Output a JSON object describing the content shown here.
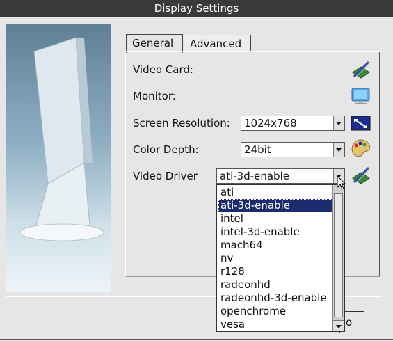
{
  "window": {
    "title": "Display Settings"
  },
  "tabs": [
    {
      "label": "General",
      "active": true
    },
    {
      "label": "Advanced",
      "active": false
    }
  ],
  "rows": {
    "video_card": {
      "label": "Video Card:",
      "icon": "video-card-config-icon"
    },
    "monitor": {
      "label": "Monitor:",
      "icon": "monitor-icon"
    },
    "resolution": {
      "label": "Screen Resolution:",
      "value": "1024x768",
      "icon": "resolution-icon"
    },
    "color_depth": {
      "label": "Color Depth:",
      "value": "24bit",
      "icon": "color-palette-icon"
    },
    "video_driver": {
      "label": "Video Driver",
      "value": "ati-3d-enable",
      "icon": "driver-config-icon"
    }
  },
  "driver_options": [
    "ati",
    "ati-3d-enable",
    "intel",
    "intel-3d-enable",
    "mach64",
    "nv",
    "r128",
    "radeonhd",
    "radeonhd-3d-enable",
    "openchrome",
    "vesa"
  ],
  "driver_selected_index": 1,
  "bottom": {
    "partial_button_label": "o"
  }
}
